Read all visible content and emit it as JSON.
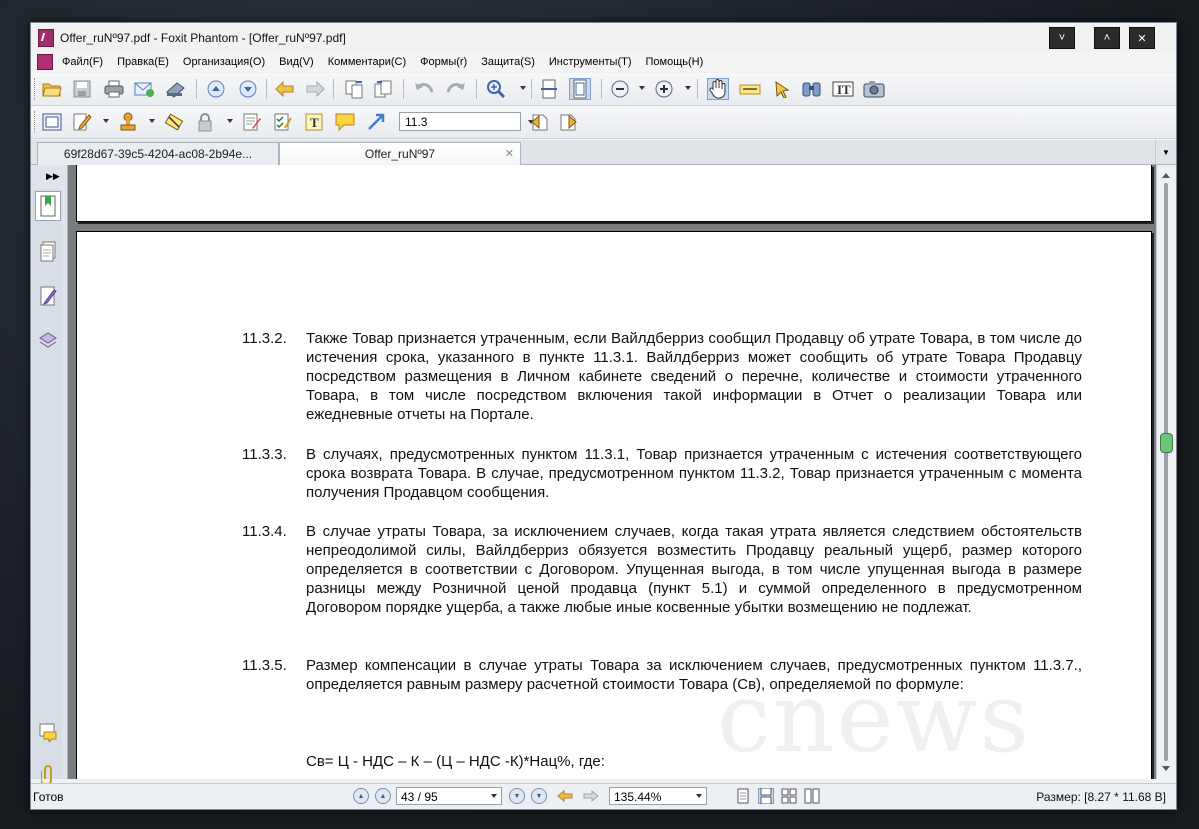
{
  "window": {
    "title": "Offer_ruNº97.pdf - Foxit Phantom - [Offer_ruNº97.pdf]",
    "buttons": {
      "dropdown": "˅",
      "maximize": "˄",
      "close": "✕"
    }
  },
  "menu": [
    "Файл(F)",
    "Правка(E)",
    "Организация(O)",
    "Вид(V)",
    "Комментари(C)",
    "Формы(r)",
    "Защита(S)",
    "Инструменты(T)",
    "Помощь(H)"
  ],
  "toolbar2": {
    "text_size": "11.3"
  },
  "tabs": [
    {
      "label": "69f28d67-39c5-4204-ac08-2b94e...",
      "active": false
    },
    {
      "label": "Offer_ruNº97",
      "active": true
    }
  ],
  "document": {
    "clauses": [
      {
        "num": "11.3.2.",
        "text": "Также Товар признается утраченным, если Вайлдберриз сообщил Продавцу об утрате Товара, в том числе до истечения срока, указанного в пункте 11.3.1. Вайлдберриз может сообщить об утрате Товара Продавцу посредством размещения в Личном кабинете сведений о перечне, количестве и стоимости утраченного Товара, в том числе посредством включения такой информации в Отчет о реализации Товара или ежедневные отчеты на Портале."
      },
      {
        "num": "11.3.3.",
        "text": "В случаях, предусмотренных пунктом 11.3.1, Товар признается утраченным с истечения соответствующего срока возврата Товара. В случае, предусмотренном пунктом 11.3.2, Товар признается утраченным с момента получения Продавцом сообщения."
      },
      {
        "num": "11.3.4.",
        "text": "В случае утраты Товара, за исключением случаев, когда такая утрата является следствием обстоятельств непреодолимой силы, Вайлдберриз обязуется возместить Продавцу реальный ущерб, размер которого определяется в соответствии с Договором. Упущенная выгода, в том числе упущенная выгода в размере разницы между Розничной ценой продавца (пункт 5.1) и суммой определенного в предусмотренном Договором порядке ущерба, а также любые иные косвенные убытки возмещению не подлежат."
      },
      {
        "num": "11.3.5.",
        "text": "Размер компенсации в случае утраты Товара за исключением случаев, предусмотренных пунктом 11.3.7., определяется равным размеру расчетной стоимости Товара (Св), определяемой по формуле:"
      }
    ],
    "formula": "Св=  Ц - НДС – К – (Ц – НДС -К)*Нац%, где:",
    "watermark": "cnews"
  },
  "statusbar": {
    "status": "Готов",
    "page_field": "43 / 95",
    "zoom_field": "135.44%",
    "size": "Размер: [8.27 * 11.68 В]"
  }
}
